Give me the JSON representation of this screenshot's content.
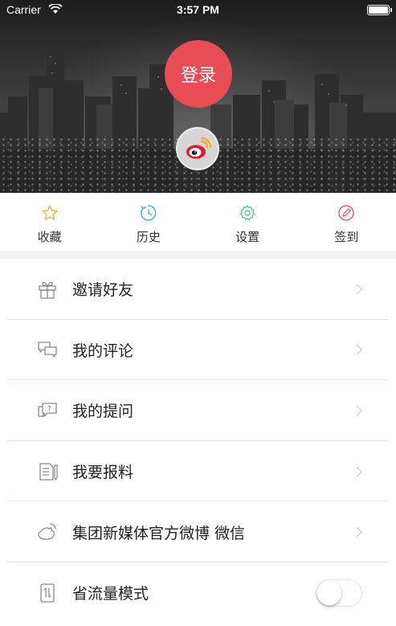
{
  "status_bar": {
    "carrier": "Carrier",
    "time": "3:57 PM"
  },
  "header": {
    "login_label": "登录"
  },
  "quick_actions": [
    {
      "label": "收藏",
      "icon": "star-icon",
      "color": "#e8b04a"
    },
    {
      "label": "历史",
      "icon": "history-icon",
      "color": "#4ab3e8"
    },
    {
      "label": "设置",
      "icon": "gear-icon",
      "color": "#5cc48a"
    },
    {
      "label": "签到",
      "icon": "sign-in-icon",
      "color": "#e85a78"
    }
  ],
  "menu": {
    "items": [
      {
        "label": "邀请好友",
        "icon": "gift-icon"
      },
      {
        "label": "我的评论",
        "icon": "comment-icon"
      },
      {
        "label": "我的提问",
        "icon": "question-icon"
      },
      {
        "label": "我要报料",
        "icon": "report-icon"
      },
      {
        "label": "集团新媒体官方微博 微信",
        "icon": "weibo-icon"
      },
      {
        "label": "省流量模式",
        "icon": "data-saver-icon"
      }
    ],
    "data_saver_enabled": false
  },
  "colors": {
    "accent": "#e84c55"
  }
}
